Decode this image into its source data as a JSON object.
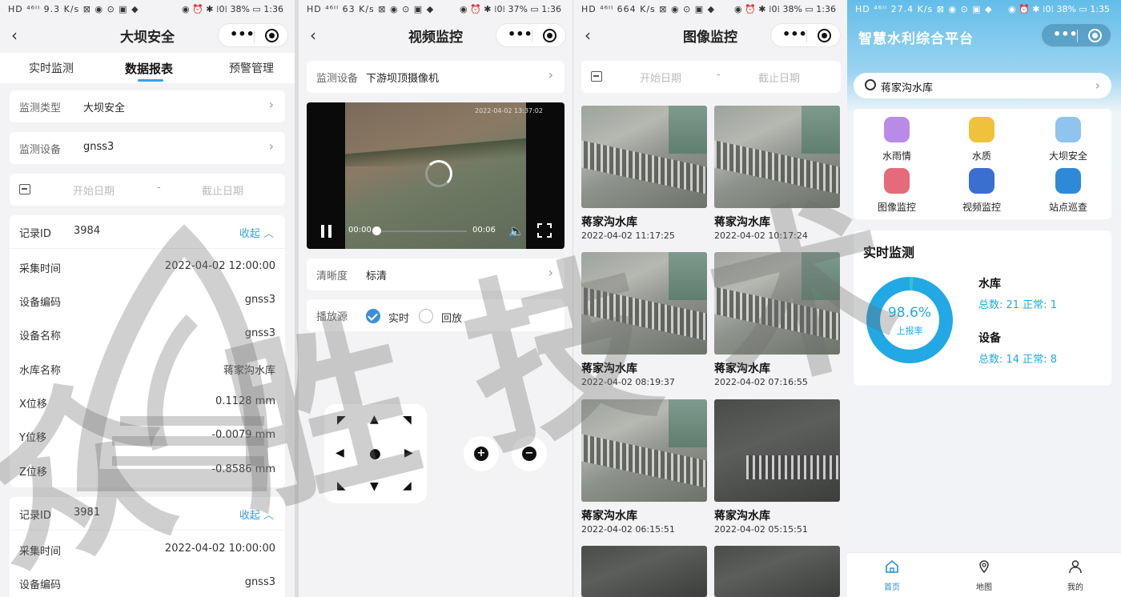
{
  "status": {
    "p1_left": "HD ⁴⁶ᴵᴵ 9.3 K/s ⊠ ◉ ⊙ ▣ ◆",
    "p1_right": "◉ ⏰ ✱ ⁞0⁞ 38% ▭ 1:36",
    "p2_left": "HD ⁴⁶ᴵᴵ 63 K/s ⊠ ◉ ⊙ ▣ ◆",
    "p2_right": "◉ ⏰ ✱ ⁞0⁞ 37% ▭ 1:36",
    "p3_left": "HD ⁴⁶ᴵᴵ 664 K/s ⊠ ◉ ⊙ ▣ ◆",
    "p3_right": "◉ ⏰ ✱ ⁞0⁞ 38% ▭ 1:36",
    "p4_left": "HD ⁴⁶ᴵᴵ 27.4 K/s ⊠ ◉ ⊙ ▣ ◆",
    "p4_right": "◉ ⏰ ✱ ⁞0⁞ 38% ▭ 1:35"
  },
  "capsule": {
    "dots": "•••"
  },
  "panel1": {
    "title": "大坝安全",
    "tabs": [
      "实时监测",
      "数据报表",
      "预警管理"
    ],
    "type_label": "监测类型",
    "type_value": "大坝安全",
    "device_label": "监测设备",
    "device_value": "gnss3",
    "start_date": "开始日期",
    "end_date": "截止日期",
    "dash": "-",
    "collapse": "收起 ︿",
    "record1": {
      "id_label": "记录ID",
      "id": "3984",
      "fields": [
        {
          "k": "采集时间",
          "v": "2022-04-02 12:00:00"
        },
        {
          "k": "设备编码",
          "v": "gnss3"
        },
        {
          "k": "设备名称",
          "v": "gnss3"
        },
        {
          "k": "水库名称",
          "v": "蒋家沟水库"
        },
        {
          "k": "X位移",
          "v": "0.1128 mm"
        },
        {
          "k": "Y位移",
          "v": "-0.0079 mm"
        },
        {
          "k": "Z位移",
          "v": "-0.8586 mm"
        }
      ]
    },
    "record2": {
      "id_label": "记录ID",
      "id": "3981",
      "fields": [
        {
          "k": "采集时间",
          "v": "2022-04-02 10:00:00"
        },
        {
          "k": "设备编码",
          "v": "gnss3"
        }
      ]
    }
  },
  "panel2": {
    "title": "视频监控",
    "device_label": "监测设备",
    "device_value": "下游坝顶摄像机",
    "video_timestamp": "2022-04-02 13:37:02",
    "time_current": "00:00",
    "time_total": "00:06",
    "clarity_label": "清晰度",
    "clarity_value": "标清",
    "source_label": "播放源",
    "source_live": "实时",
    "source_replay": "回放",
    "ptz_arrows": {
      "ul": "◤",
      "up": "▲",
      "ur": "◥",
      "left": "◀",
      "center": "●",
      "right": "▶",
      "dl": "◣",
      "down": "▼",
      "dr": "◢"
    },
    "zoom_in": "+",
    "zoom_out": "−"
  },
  "panel3": {
    "title": "图像监控",
    "start_date": "开始日期",
    "end_date": "截止日期",
    "dash": "-",
    "images": [
      {
        "name": "蒋家沟水库",
        "time": "2022-04-02 11:17:25"
      },
      {
        "name": "蒋家沟水库",
        "time": "2022-04-02 10:17:24"
      },
      {
        "name": "蒋家沟水库",
        "time": "2022-04-02 08:19:37"
      },
      {
        "name": "蒋家沟水库",
        "time": "2022-04-02 07:16:55"
      },
      {
        "name": "蒋家沟水库",
        "time": "2022-04-02 06:15:51"
      },
      {
        "name": "蒋家沟水库",
        "time": "2022-04-02 05:15:51"
      }
    ]
  },
  "panel4": {
    "title": "智慧水利综合平台",
    "reservoir": "蒋家沟水库",
    "features": [
      {
        "label": "水雨情",
        "color": "#b98be8"
      },
      {
        "label": "水质",
        "color": "#f0c13a"
      },
      {
        "label": "大坝安全",
        "color": "#8fc4ee"
      },
      {
        "label": "图像监控",
        "color": "#e56b7b"
      },
      {
        "label": "视频监控",
        "color": "#3a6fd1"
      },
      {
        "label": "站点巡查",
        "color": "#2e8ad8"
      }
    ],
    "monitor_title": "实时监测",
    "rate_value": "98.6%",
    "rate_label": "上报率",
    "rate_fraction": 0.986,
    "reservoir_heading": "水库",
    "reservoir_stats": "总数:  21   正常:  1",
    "device_heading": "设备",
    "device_stats": "总数:  14   正常:  8",
    "tabbar": [
      "首页",
      "地图",
      "我的"
    ]
  },
  "watermark": "众 胜 技 术",
  "colors": {
    "accent": "#3aa0e0",
    "primary_blue": "#22a8e4"
  }
}
